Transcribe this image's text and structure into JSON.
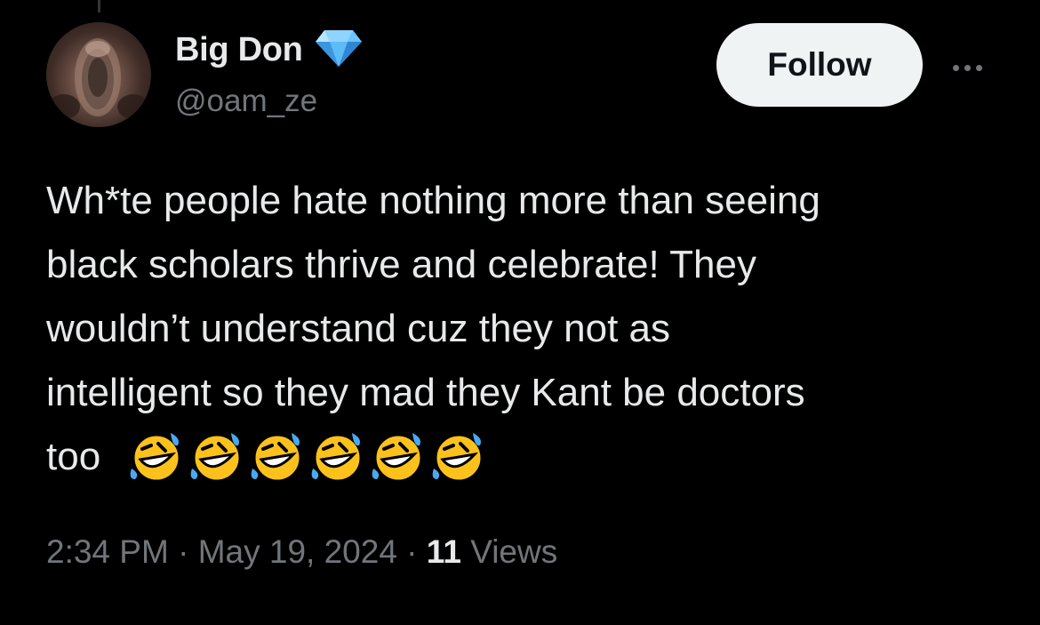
{
  "author": {
    "display_name": "Big Don",
    "handle": "@oam_ze",
    "badge_icon": "diamond-icon",
    "badge_color": "#5bb6f5"
  },
  "actions": {
    "follow_label": "Follow",
    "more_icon": "more-options-icon"
  },
  "tweet": {
    "text": "Wh*te people hate nothing more than seeing\nblack scholars thrive and celebrate! They\nwouldn’t understand cuz they not as\nintelligent so they mad they Kant be doctors\ntoo",
    "emoji_icon": "rolling-on-floor-laughing-icon",
    "emoji_count": 6
  },
  "meta": {
    "time": "2:34 PM",
    "separator": " · ",
    "date": "May 19, 2024",
    "views_count": "11",
    "views_label": "Views"
  },
  "colors": {
    "background": "#000000",
    "primary_text": "#e7e9ea",
    "secondary_text": "#71767b",
    "follow_button_bg": "#eff3f4"
  }
}
